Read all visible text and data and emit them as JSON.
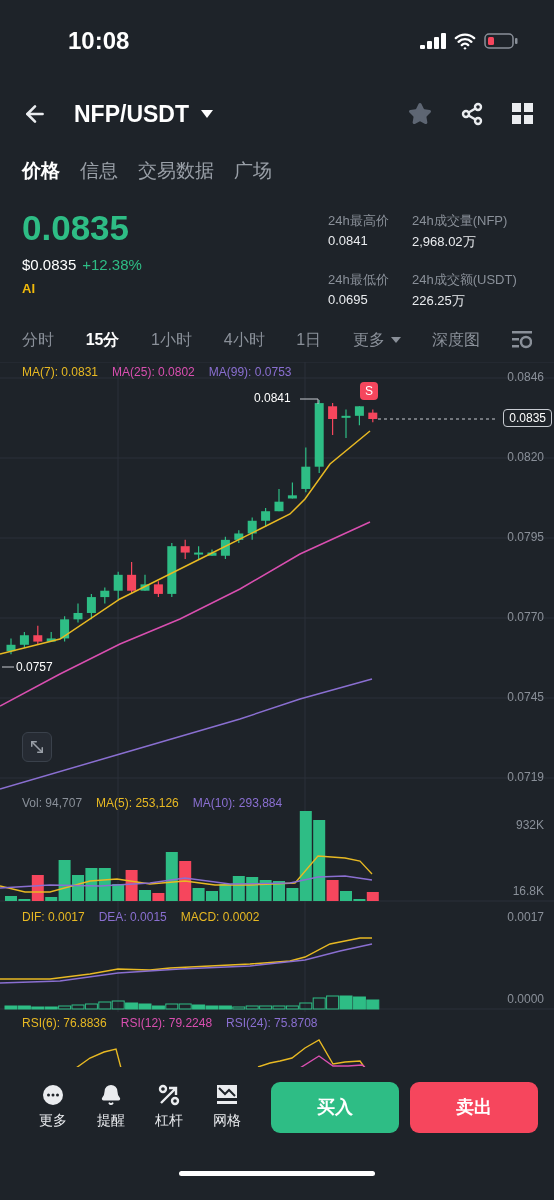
{
  "status_bar": {
    "time": "10:08"
  },
  "header": {
    "pair": "NFP/USDT"
  },
  "tabs": [
    {
      "label": "价格",
      "selected": true
    },
    {
      "label": "信息",
      "selected": false
    },
    {
      "label": "交易数据",
      "selected": false
    },
    {
      "label": "广场",
      "selected": false
    }
  ],
  "ticker": {
    "price": "0.0835",
    "usd_price": "$0.0835",
    "change": "+12.38%",
    "badge": "AI"
  },
  "stats": [
    {
      "label": "24h最高价",
      "value": "0.0841"
    },
    {
      "label": "24h成交量(NFP)",
      "value": "2,968.02万"
    },
    {
      "label": "24h最低价",
      "value": "0.0695"
    },
    {
      "label": "24h成交额(USDT)",
      "value": "226.25万"
    }
  ],
  "intervals": [
    {
      "label": "分时",
      "selected": false,
      "kind": "plain"
    },
    {
      "label": "15分",
      "selected": true,
      "kind": "plain"
    },
    {
      "label": "1小时",
      "selected": false,
      "kind": "plain"
    },
    {
      "label": "4小时",
      "selected": false,
      "kind": "plain"
    },
    {
      "label": "1日",
      "selected": false,
      "kind": "plain"
    },
    {
      "label": "更多",
      "selected": false,
      "kind": "dropdown"
    },
    {
      "label": "深度图",
      "selected": false,
      "kind": "plain"
    }
  ],
  "price_chart": {
    "legend": [
      {
        "label": "MA(7): 0.0831",
        "color": "#e8b923"
      },
      {
        "label": "MA(25): 0.0802",
        "color": "#d94fb0"
      },
      {
        "label": "MA(99): 0.0753",
        "color": "#8a6fd1"
      }
    ],
    "axis_labels": [
      "0.0846",
      "0.0820",
      "0.0795",
      "0.0770",
      "0.0745",
      "0.0719"
    ],
    "high_label": "0.0841",
    "low_label": "0.0757",
    "last_price": "0.0835",
    "signal_badge": "S"
  },
  "volume_chart": {
    "legend": [
      {
        "label": "Vol: 94,707",
        "color": "#8a9099"
      },
      {
        "label": "MA(5): 253,126",
        "color": "#e8b923"
      },
      {
        "label": "MA(10): 293,884",
        "color": "#8a6fd1"
      }
    ],
    "axis_labels": [
      "932K",
      "16.8K"
    ]
  },
  "macd_chart": {
    "legend": [
      {
        "label": "DIF: 0.0017",
        "color": "#e8b923"
      },
      {
        "label": "DEA: 0.0015",
        "color": "#8a6fd1"
      },
      {
        "label": "MACD: 0.0002",
        "color": "#e8b923"
      }
    ],
    "axis_labels": [
      "0.0017",
      "0.0000"
    ]
  },
  "rsi_chart": {
    "legend": [
      {
        "label": "RSI(6): 76.8836",
        "color": "#e8b923"
      },
      {
        "label": "RSI(12): 79.2248",
        "color": "#d94fb0"
      },
      {
        "label": "RSI(24): 75.8708",
        "color": "#8a6fd1"
      }
    ]
  },
  "bottom_bar": {
    "actions": [
      {
        "label": "更多",
        "kind": "more"
      },
      {
        "label": "提醒",
        "kind": "alert"
      },
      {
        "label": "杠杆",
        "kind": "leverage"
      },
      {
        "label": "网格",
        "kind": "grid"
      }
    ],
    "buy": "买入",
    "sell": "卖出"
  }
}
